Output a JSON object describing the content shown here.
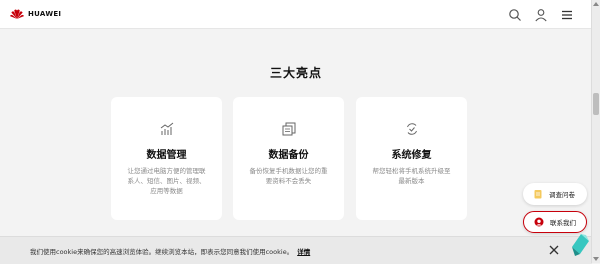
{
  "header": {
    "brand": "HUAWEI",
    "icons": [
      "search-icon",
      "user-icon",
      "menu-icon"
    ]
  },
  "section": {
    "title": "三大亮点"
  },
  "cards": [
    {
      "icon": "chart-icon",
      "title": "数据管理",
      "desc": "让您通过电脑方便的管理联系人、短信、图片、视频、应用等数据"
    },
    {
      "icon": "copy-icon",
      "title": "数据备份",
      "desc": "备份恢复手机数据让您的重要资料不会丢失"
    },
    {
      "icon": "sync-icon",
      "title": "系统修复",
      "desc": "帮您轻松将手机系统升级至最新版本"
    }
  ],
  "float": {
    "survey_label": "调查问卷",
    "contact_label": "联系我们"
  },
  "cookie": {
    "message": "我们使用cookie来确保您的高速浏览体验。继续浏览本站，即表示您同意我们使用cookie。",
    "more": "详情"
  },
  "colors": {
    "brand_red": "#c7000b",
    "page_bg": "#f3f3f3",
    "card_bg": "#ffffff"
  }
}
